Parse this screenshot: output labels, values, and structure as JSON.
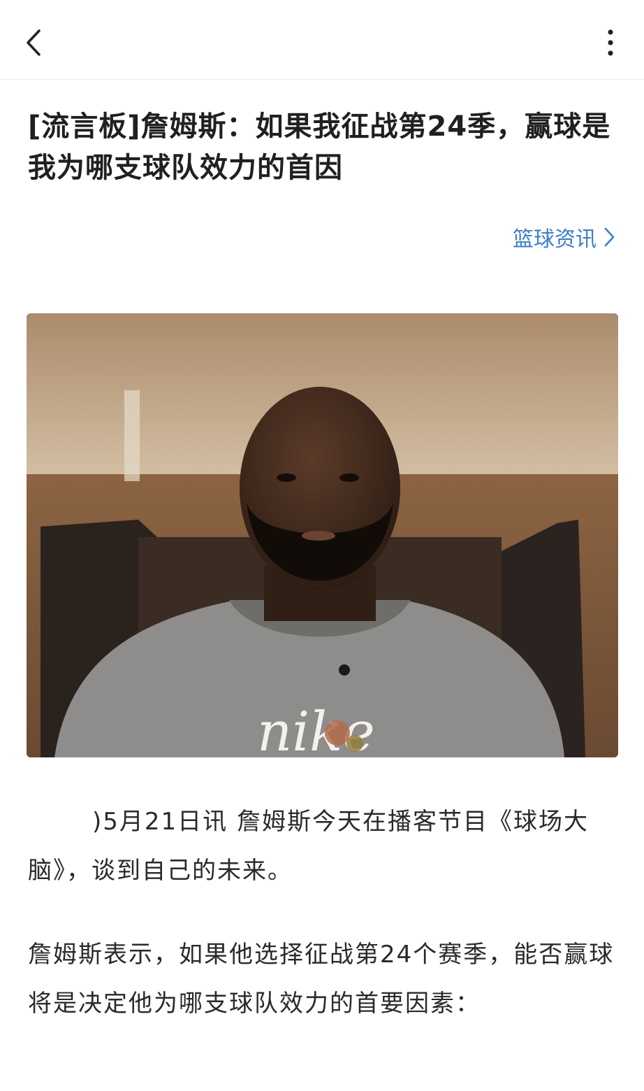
{
  "header": {
    "back_icon": "chevron-left-icon",
    "more_icon": "more-vertical-icon"
  },
  "article": {
    "title": "[流言板]詹姆斯：如果我征战第24季，赢球是我为哪支球队效力的首因",
    "category_label": "篮球资讯",
    "category_icon": "chevron-right-icon",
    "image_text": "nike",
    "paragraphs": [
      ")5月21日讯 詹姆斯今天在播客节目《球场大脑》，谈到自己的未来。",
      "詹姆斯表示，如果他选择征战第24个赛季，能否赢球将是决定他为哪支球队效力的首要因素："
    ]
  },
  "colors": {
    "accent": "#3d7ec9",
    "title_text": "#202020",
    "body_text": "#2a2a2a",
    "divider": "#ececec"
  }
}
